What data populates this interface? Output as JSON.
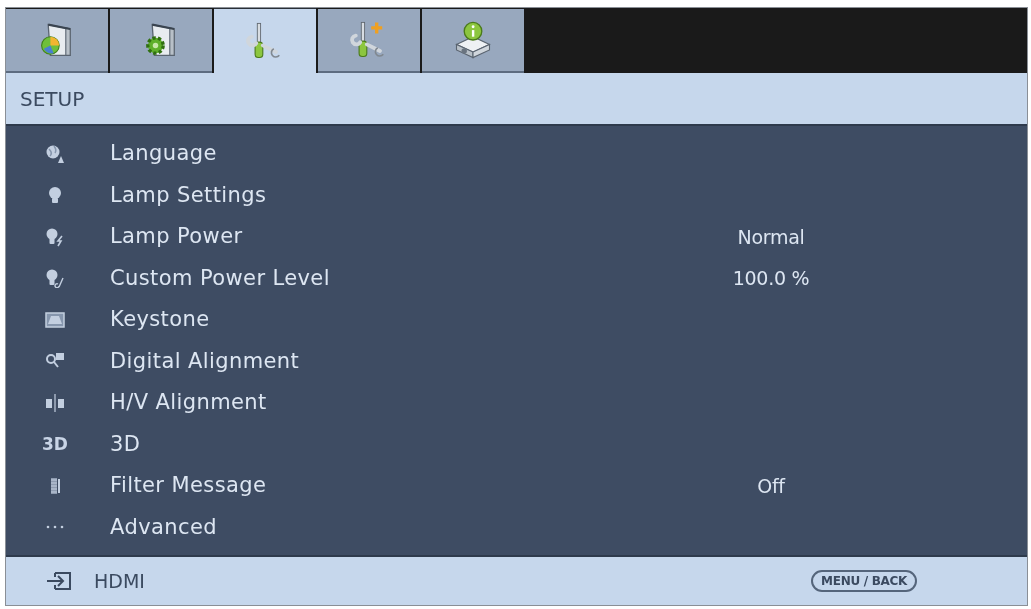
{
  "tabs": [
    {
      "selected": false
    },
    {
      "selected": false
    },
    {
      "selected": true
    },
    {
      "selected": false
    },
    {
      "selected": false
    }
  ],
  "header": {
    "title": "SETUP"
  },
  "menu": {
    "items": [
      {
        "label": "Language"
      },
      {
        "label": "Lamp Settings"
      },
      {
        "label": "Lamp Power",
        "value": "Normal"
      },
      {
        "label": "Custom Power Level",
        "value": "100.0 %"
      },
      {
        "label": "Keystone"
      },
      {
        "label": "Digital Alignment"
      },
      {
        "label": "H/V Alignment"
      },
      {
        "label": "3D",
        "icon_text": "3D"
      },
      {
        "label": "Filter Message",
        "value": "Off"
      },
      {
        "label": "Advanced"
      }
    ]
  },
  "footer": {
    "source": "HDMI",
    "button": "MENU / BACK"
  }
}
